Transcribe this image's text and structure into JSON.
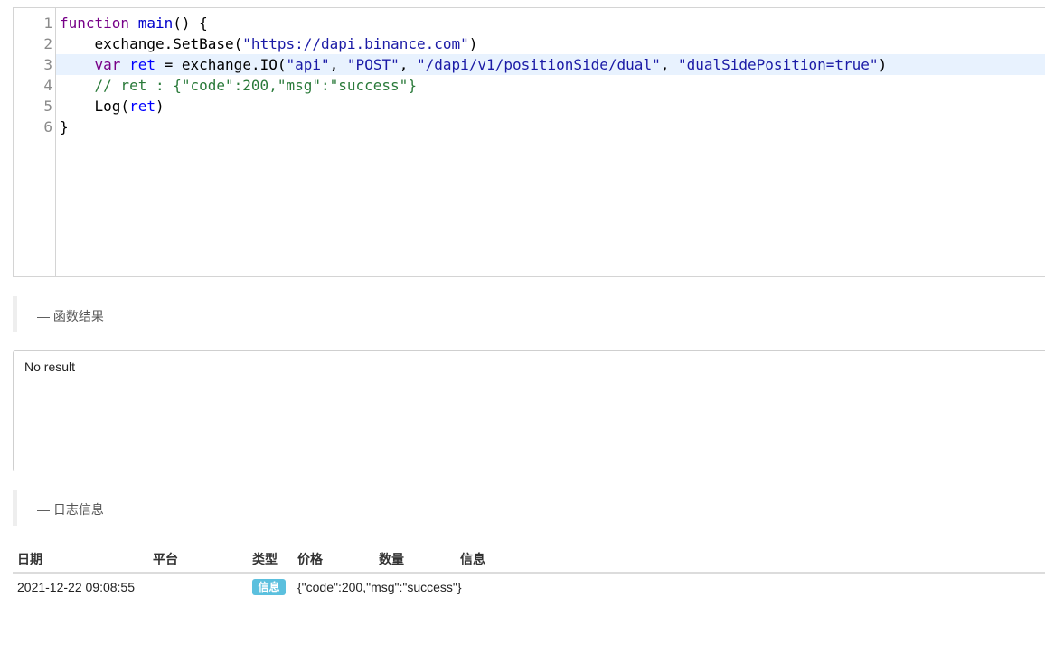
{
  "editor": {
    "lines": [
      {
        "number": "1"
      },
      {
        "number": "2"
      },
      {
        "number": "3"
      },
      {
        "number": "4"
      },
      {
        "number": "5"
      },
      {
        "number": "6"
      }
    ],
    "tokens": {
      "l1_kw": "function",
      "l1_fn": "main",
      "l1_rest": "() {",
      "l2_pre": "    exchange.SetBase(",
      "l2_str": "\"https://dapi.binance.com\"",
      "l2_post": ")",
      "l3_indent": "    ",
      "l3_kw": "var",
      "l3_var": "ret",
      "l3_mid": " = exchange.IO(",
      "l3_s1": "\"api\"",
      "l3_sep1": ", ",
      "l3_s2": "\"POST\"",
      "l3_sep2": ", ",
      "l3_s3": "\"/dapi/v1/positionSide/dual\"",
      "l3_sep3": ", ",
      "l3_s4": "\"dualSidePosition=true\"",
      "l3_end": ")",
      "l4_comment": "    // ret : {\"code\":200,\"msg\":\"success\"}",
      "l5_pre": "    Log(",
      "l5_var": "ret",
      "l5_post": ")",
      "l6": "}"
    },
    "active_line": 3
  },
  "sections": {
    "function_result": "— 函数结果",
    "log_info": "— 日志信息"
  },
  "result_box": {
    "text": "No result"
  },
  "log_table": {
    "headers": {
      "date": "日期",
      "platform": "平台",
      "type": "类型",
      "price": "价格",
      "quantity": "数量",
      "info": "信息"
    },
    "rows": [
      {
        "date": "2021-12-22 09:08:55",
        "platform": "",
        "type": "信息",
        "price": "",
        "quantity": "",
        "info": "{\"code\":200,\"msg\":\"success\"}"
      }
    ]
  },
  "colors": {
    "badge": "#5bc0de",
    "active_line": "#e8f2fe",
    "keyword": "#770088",
    "string": "#1a1aa6",
    "comment": "#2a7a3a"
  }
}
